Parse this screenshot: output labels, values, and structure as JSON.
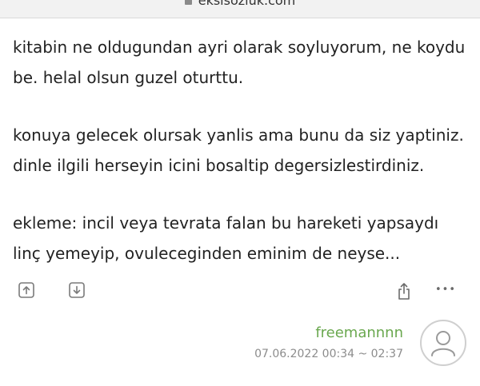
{
  "browser": {
    "url": "eksisozluk.com"
  },
  "entry": {
    "paragraphs": [
      "kitabin ne oldugundan ayri olarak soyluyorum, ne koydu be. helal olsun guzel oturttu.",
      "konuya gelecek olursak yanlis ama bunu da siz yaptiniz. dinle ilgili herseyin icini bosaltip degersizlestirdiniz.",
      "ekleme: incil veya tevrata falan bu hareketi yapsaydı linç yemeyip, ovuleceginden eminim de neyse..."
    ]
  },
  "actions": {
    "upvote_icon": "arrow-up-icon",
    "downvote_icon": "arrow-down-icon",
    "share_icon": "share-icon",
    "more_label": "•••"
  },
  "author": {
    "nick": "freemannnn",
    "date": "07.06.2022 00:34 ~ 02:37"
  },
  "colors": {
    "nick": "#6aa84f",
    "date": "#8c8c8c",
    "icon": "#7a7a7a"
  }
}
